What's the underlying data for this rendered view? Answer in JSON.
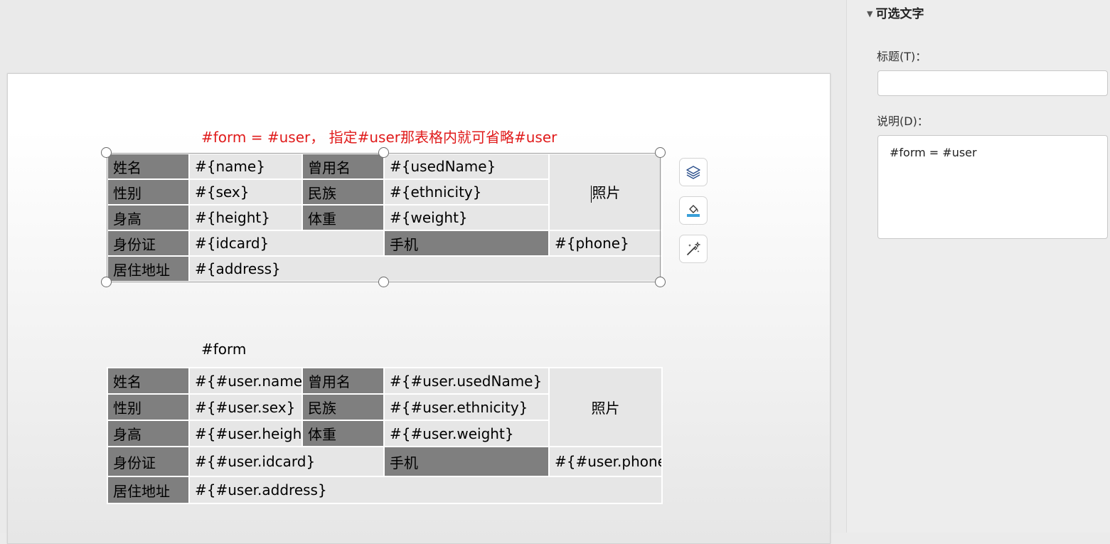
{
  "document": {
    "caption1": "#form = #user， 指定#user那表格内就可省略#user",
    "caption2": "#form",
    "table1": {
      "name_label": "姓名",
      "name_value": "#{name}",
      "used_name_label": "曾用名",
      "used_name_value": "#{usedName}",
      "photo": "照片",
      "sex_label": "性别",
      "sex_value": "#{sex}",
      "ethnicity_label": "民族",
      "ethnicity_value": "#{ethnicity}",
      "height_label": "身高",
      "height_value": "#{height}",
      "weight_label": "体重",
      "weight_value": "#{weight}",
      "idcard_label": "身份证",
      "idcard_value": "#{idcard}",
      "phone_label": "手机",
      "phone_value": "#{phone}",
      "address_label": "居住地址",
      "address_value": "#{address}"
    },
    "table2": {
      "name_label": "姓名",
      "name_value": "#{#user.name}",
      "used_name_label": "曾用名",
      "used_name_value": "#{#user.usedName}",
      "photo": "照片",
      "sex_label": "性别",
      "sex_value": "#{#user.sex}",
      "ethnicity_label": "民族",
      "ethnicity_value": "#{#user.ethnicity}",
      "height_label": "身高",
      "height_value": "#{#user.height}",
      "weight_label": "体重",
      "weight_value": "#{#user.weight}",
      "idcard_label": "身份证",
      "idcard_value": "#{#user.idcard}",
      "phone_label": "手机",
      "phone_value": "#{#user.phone}",
      "address_label": "居住地址",
      "address_value": "#{#user.address}"
    }
  },
  "float_toolbar": {
    "icons": [
      "layers-icon",
      "fill-color-icon",
      "magic-wand-icon"
    ]
  },
  "panel": {
    "title": "可选文字",
    "title_field_label": "标题(T)：",
    "title_field_value": "",
    "desc_field_label": "说明(D)：",
    "desc_field_value": "#form = #user"
  },
  "colors": {
    "caption_red": "#e01b1b",
    "label_cell": "#7f7f7f",
    "value_cell": "#e6e6e6",
    "accent": "#3a6fc4"
  }
}
